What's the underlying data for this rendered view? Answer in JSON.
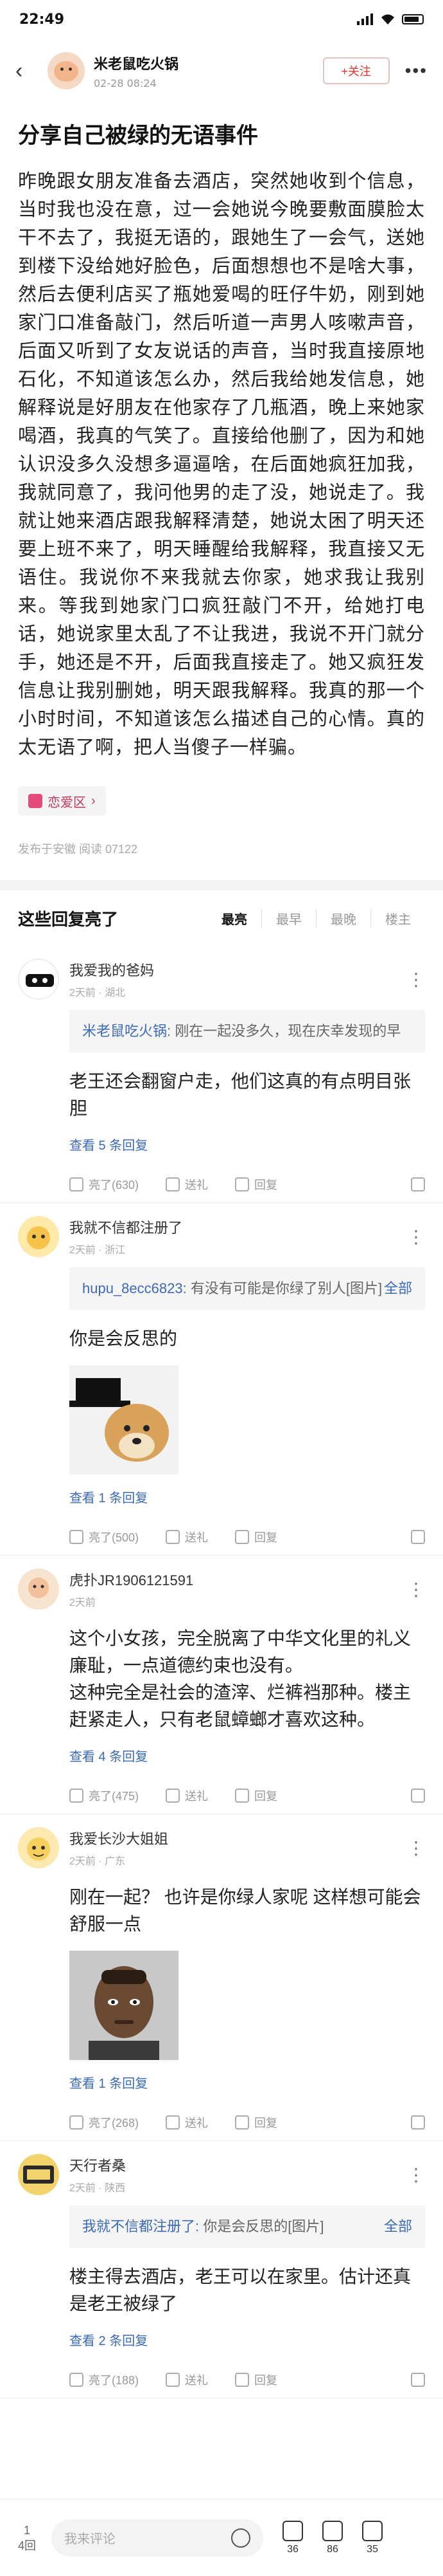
{
  "status": {
    "time": "22:49"
  },
  "header": {
    "author": "米老鼠吃火锅",
    "date": "02-28 08:24",
    "follow_label": "+关注"
  },
  "article": {
    "title": "分享自己被绿的无语事件",
    "body": "昨晚跟女朋友准备去酒店，突然她收到个信息，当时我也没在意，过一会她说今晚要敷面膜脸太干不去了，我挺无语的，跟她生了一会气，送她到楼下没给她好脸色，后面想想也不是啥大事，然后去便利店买了瓶她爱喝的旺仔牛奶，刚到她家门口准备敲门，然后听道一声男人咳嗽声音，后面又听到了女友说话的声音，当时我直接原地石化，不知道该怎么办，然后我给她发信息，她解释说是好朋友在他家存了几瓶酒，晚上来她家喝酒，我真的气笑了。直接给他删了，因为和她认识没多久没想多逼逼啥，在后面她疯狂加我，我就同意了，我问他男的走了没，她说走了。我就让她来酒店跟我解释清楚，她说太困了明天还要上班不来了，明天睡醒给我解释，我直接又无语住。我说你不来我就去你家，她求我让我别来。等我到她家门口疯狂敲门不开，给她打电话，她说家里太乱了不让我进，我说不开门就分手，她还是不开，后面我直接走了。她又疯狂发信息让我别删她，明天跟我解释。我真的那一个小时时间，不知道该怎么描述自己的心情。真的太无语了啊，把人当傻子一样骗。",
    "tag": "恋爱区",
    "meta": "发布于安徽  阅读 07122"
  },
  "replies": {
    "section_title": "这些回复亮了",
    "sort_tabs": [
      "最亮",
      "最早",
      "最晚",
      "楼主"
    ],
    "comments": [
      {
        "name": "我爱我的爸妈",
        "time": "2天前 · 湖北",
        "quote_name": "米老鼠吃火锅:",
        "quote_text": "刚在一起没多久，现在庆幸发现的早",
        "text": "老王还会翻窗户走，他们这真的有点明目张胆",
        "more": "查看 5 条回复",
        "likes": "亮了(630)",
        "gift": "送礼",
        "reply": "回复"
      },
      {
        "name": "我就不信都注册了",
        "time": "2天前 · 浙江",
        "quote_name": "hupu_8ecc6823:",
        "quote_text": "有没有可能是你绿了别人[图片]",
        "quote_all": "全部",
        "text": "你是会反思的",
        "more": "查看 1 条回复",
        "likes": "亮了(500)",
        "gift": "送礼",
        "reply": "回复"
      },
      {
        "name": "虎扑JR1906121591",
        "time": "2天前",
        "text": "这个小女孩，完全脱离了中华文化里的礼义廉耻，一点道德约束也没有。\n这种完全是社会的渣滓、烂裤裆那种。楼主赶紧走人，只有老鼠蟑螂才喜欢这种。",
        "more": "查看 4 条回复",
        "likes": "亮了(475)",
        "gift": "送礼",
        "reply": "回复"
      },
      {
        "name": "我爱长沙大姐姐",
        "time": "2天前 · 广东",
        "text": "刚在一起？ 也许是你绿人家呢 这样想可能会舒服一点",
        "more": "查看 1 条回复",
        "likes": "亮了(268)",
        "gift": "送礼",
        "reply": "回复"
      },
      {
        "name": "天行者桑",
        "time": "2天前 · 陕西",
        "quote_name": "我就不信都注册了:",
        "quote_text": "你是会反思的[图片]",
        "quote_all": "全部",
        "text": "楼主得去酒店，老王可以在家里。估计还真是老王被绿了",
        "more": "查看 2 条回复",
        "likes": "亮了(188)",
        "gift": "送礼",
        "reply": "回复"
      }
    ]
  },
  "bottom": {
    "floor_count": "1",
    "floor_label": "4回",
    "reply_placeholder": "我来评论",
    "light_count": "36",
    "gift_count": "86",
    "fav_count": "35"
  }
}
